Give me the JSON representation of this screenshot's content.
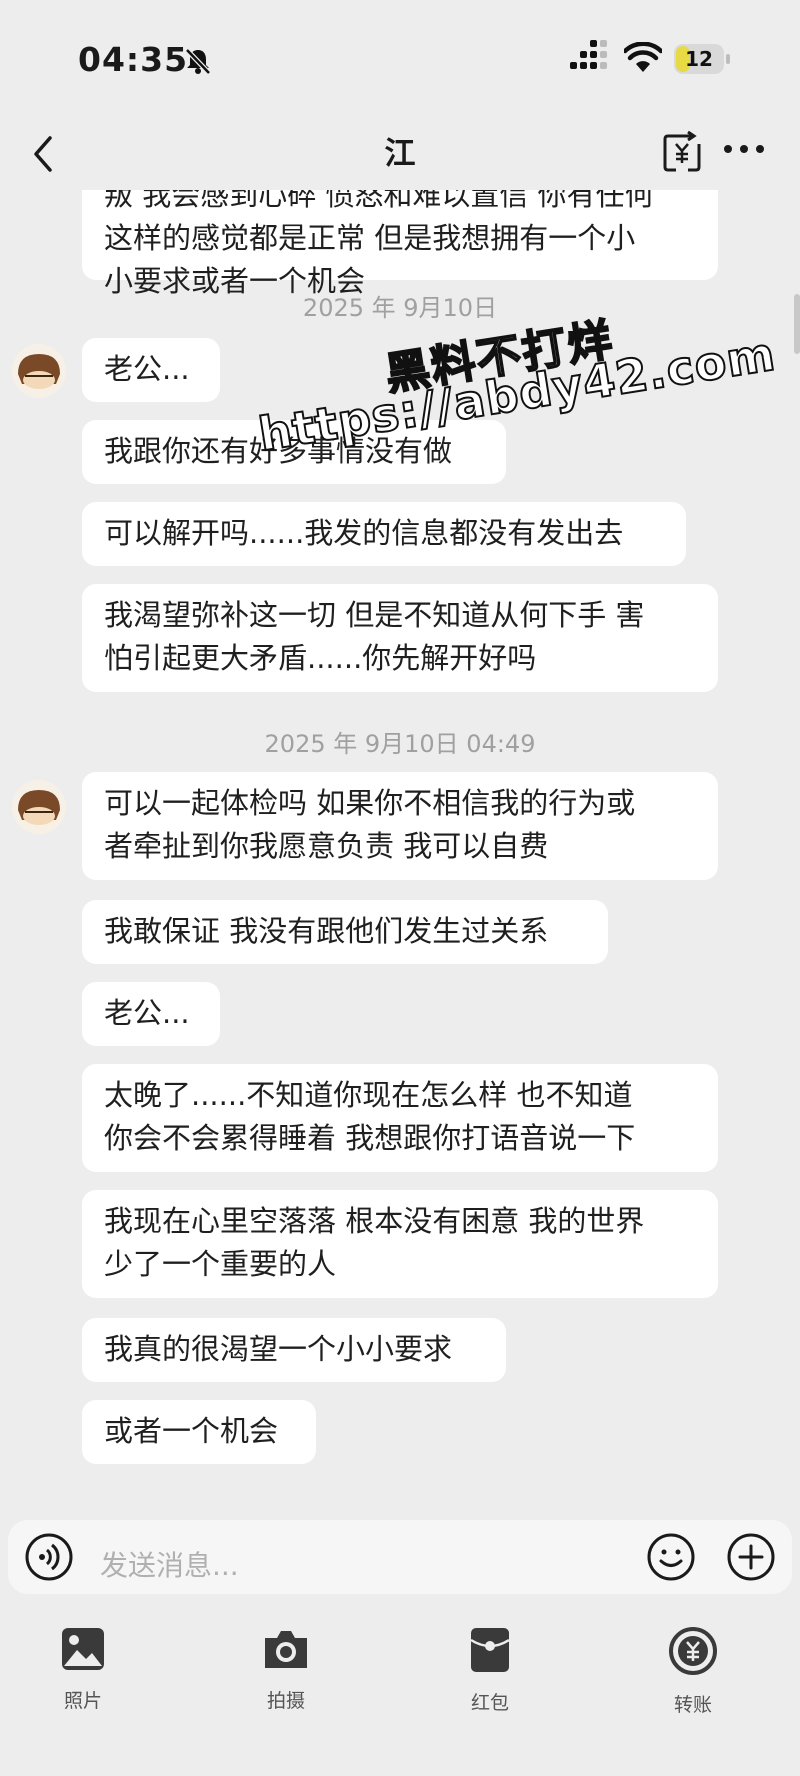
{
  "status_bar": {
    "time": "04:35",
    "battery": "12"
  },
  "header": {
    "title": "江"
  },
  "messages": [
    {
      "lines": [
        "叛 我会感到心碎 愤怒和难以置信 你有任何",
        "这样的感觉都是正常 但是我想拥有一个小",
        "小要求或者一个机会"
      ]
    },
    {
      "timestamp": "2025 年 9月10日"
    },
    {
      "lines": [
        "老公..."
      ]
    },
    {
      "lines": [
        "我跟你还有好多事情没有做"
      ]
    },
    {
      "lines": [
        "可以解开吗......我发的信息都没有发出去"
      ]
    },
    {
      "lines": [
        "我渴望弥补这一切 但是不知道从何下手 害",
        "怕引起更大矛盾......你先解开好吗"
      ]
    },
    {
      "timestamp": "2025 年 9月10日 04:49"
    },
    {
      "lines": [
        "可以一起体检吗 如果你不相信我的行为或",
        "者牵扯到你我愿意负责 我可以自费"
      ]
    },
    {
      "lines": [
        "我敢保证 我没有跟他们发生过关系"
      ]
    },
    {
      "lines": [
        "老公..."
      ]
    },
    {
      "lines": [
        "太晚了......不知道你现在怎么样 也不知道",
        "你会不会累得睡着 我想跟你打语音说一下"
      ]
    },
    {
      "lines": [
        "我现在心里空落落 根本没有困意 我的世界",
        "少了一个重要的人"
      ]
    },
    {
      "lines": [
        "我真的很渴望一个小小要求"
      ]
    },
    {
      "lines": [
        "或者一个机会"
      ]
    }
  ],
  "watermark": {
    "line1": "黑料不打烊",
    "line2": "https://abdy42.com"
  },
  "input": {
    "placeholder": "发送消息..."
  },
  "toolbar": {
    "photo": "照片",
    "camera": "拍摄",
    "red_packet": "红包",
    "transfer": "转账"
  },
  "colors": {
    "background": "#ededed",
    "bubble": "#ffffff",
    "red_packet": "#3a3a3a",
    "battery": "#e7da45"
  }
}
